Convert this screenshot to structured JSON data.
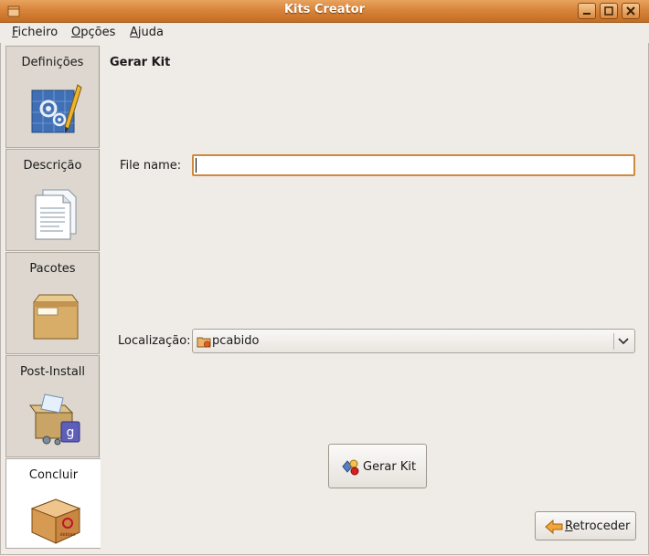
{
  "window": {
    "title": "Kits Creator"
  },
  "menu": {
    "items": [
      {
        "label": "Ficheiro",
        "mnemonic": "F",
        "rest": "icheiro"
      },
      {
        "label": "Opções",
        "mnemonic": "O",
        "rest": "pções"
      },
      {
        "label": "Ajuda",
        "mnemonic": "A",
        "rest": "juda"
      }
    ]
  },
  "sidebar": {
    "items": [
      {
        "label": "Definições",
        "icon": "gear-blueprint-icon"
      },
      {
        "label": "Descrição",
        "icon": "document-icon"
      },
      {
        "label": "Pacotes",
        "icon": "package-box-icon"
      },
      {
        "label": "Post-Install",
        "icon": "install-package-icon"
      },
      {
        "label": "Concluir",
        "icon": "debian-package-icon",
        "active": true
      }
    ]
  },
  "content": {
    "title": "Gerar Kit",
    "file_name_label": "File name:",
    "file_name_value": "",
    "location_label": "Localização:",
    "location_value": "pcabido"
  },
  "buttons": {
    "generate": "Gerar Kit",
    "back_mnemonic": "R",
    "back_rest": "etroceder",
    "back": "Retroceder"
  },
  "colors": {
    "titlebar": "#d8853b",
    "focus_border": "#d08a3b",
    "background": "#efebe7"
  }
}
